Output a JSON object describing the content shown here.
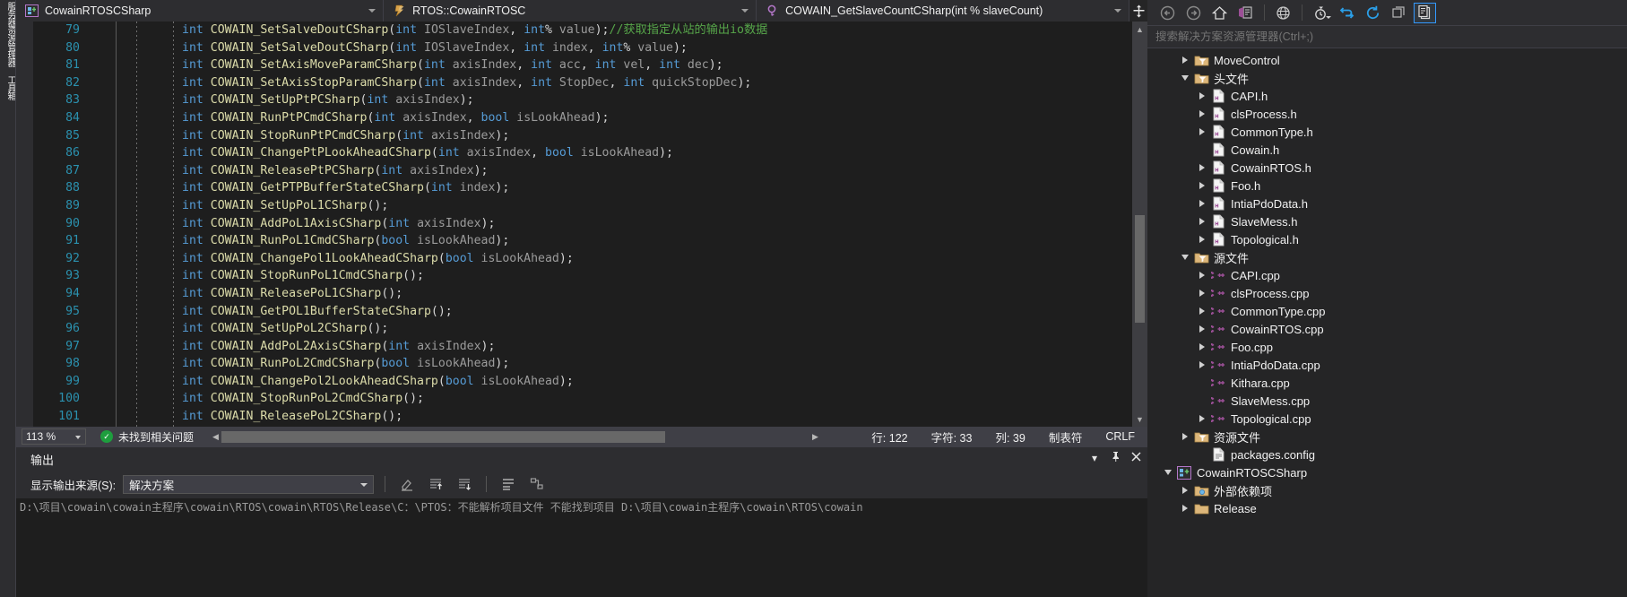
{
  "vertical_dock": {
    "tabs": [
      "服务器资源管理器",
      "工具箱"
    ]
  },
  "navigation_bar": {
    "project": {
      "label": "CowainRTOSCSharp",
      "icon": "cpp-project-icon"
    },
    "type": {
      "label": "RTOS::CowainRTOSC",
      "icon": "namespace-icon"
    },
    "member": {
      "label": "COWAIN_GetSlaveCountCSharp(int % slaveCount)",
      "icon": "method-icon"
    },
    "split_icon": "split-view-icon"
  },
  "editor": {
    "first_line": 79,
    "lines": [
      {
        "n": 79,
        "tokens": [
          [
            "kw",
            "int"
          ],
          [
            "pun",
            " "
          ],
          [
            "fn",
            "COWAIN_SetSalveDoutCSharp"
          ],
          [
            "pun",
            "("
          ],
          [
            "kw",
            "int"
          ],
          [
            "pun",
            " "
          ],
          [
            "id",
            "IOSlaveIndex"
          ],
          [
            "pun",
            ", "
          ],
          [
            "kw",
            "int"
          ],
          [
            "pun",
            "% "
          ],
          [
            "id",
            "value"
          ],
          [
            "pun",
            ");"
          ],
          [
            "cmt",
            "//获取指定从站的输出io数据"
          ]
        ]
      },
      {
        "n": 80,
        "tokens": [
          [
            "kw",
            "int"
          ],
          [
            "pun",
            " "
          ],
          [
            "fn",
            "COWAIN_SetSalveDoutCSharp"
          ],
          [
            "pun",
            "("
          ],
          [
            "kw",
            "int"
          ],
          [
            "pun",
            " "
          ],
          [
            "id",
            "IOSlaveIndex"
          ],
          [
            "pun",
            ", "
          ],
          [
            "kw",
            "int"
          ],
          [
            "pun",
            " "
          ],
          [
            "id",
            "index"
          ],
          [
            "pun",
            ", "
          ],
          [
            "kw",
            "int"
          ],
          [
            "pun",
            "% "
          ],
          [
            "id",
            "value"
          ],
          [
            "pun",
            ");"
          ]
        ]
      },
      {
        "n": 81,
        "tokens": [
          [
            "kw",
            "int"
          ],
          [
            "pun",
            " "
          ],
          [
            "fn",
            "COWAIN_SetAxisMoveParamCSharp"
          ],
          [
            "pun",
            "("
          ],
          [
            "kw",
            "int"
          ],
          [
            "pun",
            " "
          ],
          [
            "id",
            "axisIndex"
          ],
          [
            "pun",
            ", "
          ],
          [
            "kw",
            "int"
          ],
          [
            "pun",
            " "
          ],
          [
            "id",
            "acc"
          ],
          [
            "pun",
            ", "
          ],
          [
            "kw",
            "int"
          ],
          [
            "pun",
            " "
          ],
          [
            "id",
            "vel"
          ],
          [
            "pun",
            ", "
          ],
          [
            "kw",
            "int"
          ],
          [
            "pun",
            " "
          ],
          [
            "id",
            "dec"
          ],
          [
            "pun",
            ");"
          ]
        ]
      },
      {
        "n": 82,
        "tokens": [
          [
            "kw",
            "int"
          ],
          [
            "pun",
            " "
          ],
          [
            "fn",
            "COWAIN_SetAxisStopParamCSharp"
          ],
          [
            "pun",
            "("
          ],
          [
            "kw",
            "int"
          ],
          [
            "pun",
            " "
          ],
          [
            "id",
            "axisIndex"
          ],
          [
            "pun",
            ", "
          ],
          [
            "kw",
            "int"
          ],
          [
            "pun",
            " "
          ],
          [
            "id",
            "StopDec"
          ],
          [
            "pun",
            ", "
          ],
          [
            "kw",
            "int"
          ],
          [
            "pun",
            " "
          ],
          [
            "id",
            "quickStopDec"
          ],
          [
            "pun",
            ");"
          ]
        ]
      },
      {
        "n": 83,
        "tokens": [
          [
            "kw",
            "int"
          ],
          [
            "pun",
            " "
          ],
          [
            "fn",
            "COWAIN_SetUpPtPCSharp"
          ],
          [
            "pun",
            "("
          ],
          [
            "kw",
            "int"
          ],
          [
            "pun",
            " "
          ],
          [
            "id",
            "axisIndex"
          ],
          [
            "pun",
            ");"
          ]
        ]
      },
      {
        "n": 84,
        "tokens": [
          [
            "kw",
            "int"
          ],
          [
            "pun",
            " "
          ],
          [
            "fn",
            "COWAIN_RunPtPCmdCSharp"
          ],
          [
            "pun",
            "("
          ],
          [
            "kw",
            "int"
          ],
          [
            "pun",
            " "
          ],
          [
            "id",
            "axisIndex"
          ],
          [
            "pun",
            ", "
          ],
          [
            "kw",
            "bool"
          ],
          [
            "pun",
            " "
          ],
          [
            "id",
            "isLookAhead"
          ],
          [
            "pun",
            ");"
          ]
        ]
      },
      {
        "n": 85,
        "tokens": [
          [
            "kw",
            "int"
          ],
          [
            "pun",
            " "
          ],
          [
            "fn",
            "COWAIN_StopRunPtPCmdCSharp"
          ],
          [
            "pun",
            "("
          ],
          [
            "kw",
            "int"
          ],
          [
            "pun",
            " "
          ],
          [
            "id",
            "axisIndex"
          ],
          [
            "pun",
            ");"
          ]
        ]
      },
      {
        "n": 86,
        "tokens": [
          [
            "kw",
            "int"
          ],
          [
            "pun",
            " "
          ],
          [
            "fn",
            "COWAIN_ChangePtPLookAheadCSharp"
          ],
          [
            "pun",
            "("
          ],
          [
            "kw",
            "int"
          ],
          [
            "pun",
            " "
          ],
          [
            "id",
            "axisIndex"
          ],
          [
            "pun",
            ", "
          ],
          [
            "kw",
            "bool"
          ],
          [
            "pun",
            " "
          ],
          [
            "id",
            "isLookAhead"
          ],
          [
            "pun",
            ");"
          ]
        ]
      },
      {
        "n": 87,
        "tokens": [
          [
            "kw",
            "int"
          ],
          [
            "pun",
            " "
          ],
          [
            "fn",
            "COWAIN_ReleasePtPCSharp"
          ],
          [
            "pun",
            "("
          ],
          [
            "kw",
            "int"
          ],
          [
            "pun",
            " "
          ],
          [
            "id",
            "axisIndex"
          ],
          [
            "pun",
            ");"
          ]
        ]
      },
      {
        "n": 88,
        "tokens": [
          [
            "kw",
            "int"
          ],
          [
            "pun",
            " "
          ],
          [
            "fn",
            "COWAIN_GetPTPBufferStateCSharp"
          ],
          [
            "pun",
            "("
          ],
          [
            "kw",
            "int"
          ],
          [
            "pun",
            " "
          ],
          [
            "id",
            "index"
          ],
          [
            "pun",
            ");"
          ]
        ]
      },
      {
        "n": 89,
        "tokens": [
          [
            "kw",
            "int"
          ],
          [
            "pun",
            " "
          ],
          [
            "fn",
            "COWAIN_SetUpPoL1CSharp"
          ],
          [
            "pun",
            "();"
          ]
        ]
      },
      {
        "n": 90,
        "tokens": [
          [
            "kw",
            "int"
          ],
          [
            "pun",
            " "
          ],
          [
            "fn",
            "COWAIN_AddPoL1AxisCSharp"
          ],
          [
            "pun",
            "("
          ],
          [
            "kw",
            "int"
          ],
          [
            "pun",
            " "
          ],
          [
            "id",
            "axisIndex"
          ],
          [
            "pun",
            ");"
          ]
        ]
      },
      {
        "n": 91,
        "tokens": [
          [
            "kw",
            "int"
          ],
          [
            "pun",
            " "
          ],
          [
            "fn",
            "COWAIN_RunPoL1CmdCSharp"
          ],
          [
            "pun",
            "("
          ],
          [
            "kw",
            "bool"
          ],
          [
            "pun",
            " "
          ],
          [
            "id",
            "isLookAhead"
          ],
          [
            "pun",
            ");"
          ]
        ]
      },
      {
        "n": 92,
        "tokens": [
          [
            "kw",
            "int"
          ],
          [
            "pun",
            " "
          ],
          [
            "fn",
            "COWAIN_ChangePol1LookAheadCSharp"
          ],
          [
            "pun",
            "("
          ],
          [
            "kw",
            "bool"
          ],
          [
            "pun",
            " "
          ],
          [
            "id",
            "isLookAhead"
          ],
          [
            "pun",
            ");"
          ]
        ]
      },
      {
        "n": 93,
        "tokens": [
          [
            "kw",
            "int"
          ],
          [
            "pun",
            " "
          ],
          [
            "fn",
            "COWAIN_StopRunPoL1CmdCSharp"
          ],
          [
            "pun",
            "();"
          ]
        ]
      },
      {
        "n": 94,
        "tokens": [
          [
            "kw",
            "int"
          ],
          [
            "pun",
            " "
          ],
          [
            "fn",
            "COWAIN_ReleasePoL1CSharp"
          ],
          [
            "pun",
            "();"
          ]
        ]
      },
      {
        "n": 95,
        "tokens": [
          [
            "kw",
            "int"
          ],
          [
            "pun",
            " "
          ],
          [
            "fn",
            "COWAIN_GetPOL1BufferStateCSharp"
          ],
          [
            "pun",
            "();"
          ]
        ]
      },
      {
        "n": 96,
        "tokens": [
          [
            "kw",
            "int"
          ],
          [
            "pun",
            " "
          ],
          [
            "fn",
            "COWAIN_SetUpPoL2CSharp"
          ],
          [
            "pun",
            "();"
          ]
        ]
      },
      {
        "n": 97,
        "tokens": [
          [
            "kw",
            "int"
          ],
          [
            "pun",
            " "
          ],
          [
            "fn",
            "COWAIN_AddPoL2AxisCSharp"
          ],
          [
            "pun",
            "("
          ],
          [
            "kw",
            "int"
          ],
          [
            "pun",
            " "
          ],
          [
            "id",
            "axisIndex"
          ],
          [
            "pun",
            ");"
          ]
        ]
      },
      {
        "n": 98,
        "tokens": [
          [
            "kw",
            "int"
          ],
          [
            "pun",
            " "
          ],
          [
            "fn",
            "COWAIN_RunPoL2CmdCSharp"
          ],
          [
            "pun",
            "("
          ],
          [
            "kw",
            "bool"
          ],
          [
            "pun",
            " "
          ],
          [
            "id",
            "isLookAhead"
          ],
          [
            "pun",
            ");"
          ]
        ]
      },
      {
        "n": 99,
        "tokens": [
          [
            "kw",
            "int"
          ],
          [
            "pun",
            " "
          ],
          [
            "fn",
            "COWAIN_ChangePol2LookAheadCSharp"
          ],
          [
            "pun",
            "("
          ],
          [
            "kw",
            "bool"
          ],
          [
            "pun",
            " "
          ],
          [
            "id",
            "isLookAhead"
          ],
          [
            "pun",
            ");"
          ]
        ]
      },
      {
        "n": 100,
        "tokens": [
          [
            "kw",
            "int"
          ],
          [
            "pun",
            " "
          ],
          [
            "fn",
            "COWAIN_StopRunPoL2CmdCSharp"
          ],
          [
            "pun",
            "();"
          ]
        ]
      },
      {
        "n": 101,
        "tokens": [
          [
            "kw",
            "int"
          ],
          [
            "pun",
            " "
          ],
          [
            "fn",
            "COWAIN_ReleasePoL2CSharp"
          ],
          [
            "pun",
            "();"
          ]
        ]
      }
    ]
  },
  "editor_status": {
    "zoom": "113 %",
    "problems": "未找到相关问题",
    "line_label": "行: 122",
    "char_label": "字符: 33",
    "col_label": "列: 39",
    "tabs_label": "制表符",
    "eol_label": "CRLF"
  },
  "output": {
    "title": "输出",
    "source_label": "显示输出来源(S):",
    "source_value": "解决方案",
    "toolbar_icons": [
      "clear-output-icon",
      "scroll-up-icon",
      "scroll-down-icon",
      "word-wrap-icon",
      "toggle-tree-icon"
    ],
    "header_icons": [
      "chevron-down-icon",
      "pin-icon",
      "close-icon"
    ],
    "body_text": "D:\\项目\\cowain\\cowain主程序\\cowain\\RTOS\\cowain\\RTOS\\Release\\C：\\PTOS：不能解析项目文件 不能找到项目 D:\\项目\\cowain主程序\\cowain\\RTOS\\cowain"
  },
  "solution_explorer": {
    "toolbar": [
      "back-icon",
      "forward-icon",
      "home-icon",
      "sync-with-active-document-icon",
      "globe-icon",
      "pending-changes-filter-icon",
      "refresh-icon",
      "collapse-all-icon",
      "show-all-files-icon",
      "properties-icon"
    ],
    "search_placeholder": "搜索解决方案资源管理器(Ctrl+;)",
    "tree": [
      {
        "label": "MoveControl",
        "icon": "filter-folder-icon",
        "indent": 1,
        "state": "collapsed"
      },
      {
        "label": "头文件",
        "icon": "filter-folder-icon",
        "indent": 1,
        "state": "expanded"
      },
      {
        "label": "CAPI.h",
        "icon": "h-file-icon",
        "indent": 2,
        "state": "collapsed"
      },
      {
        "label": "clsProcess.h",
        "icon": "h-file-icon",
        "indent": 2,
        "state": "collapsed"
      },
      {
        "label": "CommonType.h",
        "icon": "h-file-icon",
        "indent": 2,
        "state": "collapsed"
      },
      {
        "label": "Cowain.h",
        "icon": "h-file-icon",
        "indent": 2,
        "state": "none"
      },
      {
        "label": "CowainRTOS.h",
        "icon": "h-file-icon",
        "indent": 2,
        "state": "collapsed"
      },
      {
        "label": "Foo.h",
        "icon": "h-file-icon",
        "indent": 2,
        "state": "collapsed"
      },
      {
        "label": "IntiaPdoData.h",
        "icon": "h-file-icon",
        "indent": 2,
        "state": "collapsed"
      },
      {
        "label": "SlaveMess.h",
        "icon": "h-file-icon",
        "indent": 2,
        "state": "collapsed"
      },
      {
        "label": "Topological.h",
        "icon": "h-file-icon",
        "indent": 2,
        "state": "collapsed"
      },
      {
        "label": "源文件",
        "icon": "filter-folder-icon",
        "indent": 1,
        "state": "expanded"
      },
      {
        "label": "CAPI.cpp",
        "icon": "cpp-file-icon",
        "indent": 2,
        "state": "collapsed"
      },
      {
        "label": "clsProcess.cpp",
        "icon": "cpp-file-icon",
        "indent": 2,
        "state": "collapsed"
      },
      {
        "label": "CommonType.cpp",
        "icon": "cpp-file-icon",
        "indent": 2,
        "state": "collapsed"
      },
      {
        "label": "CowainRTOS.cpp",
        "icon": "cpp-file-icon",
        "indent": 2,
        "state": "collapsed"
      },
      {
        "label": "Foo.cpp",
        "icon": "cpp-file-icon",
        "indent": 2,
        "state": "collapsed"
      },
      {
        "label": "IntiaPdoData.cpp",
        "icon": "cpp-file-icon",
        "indent": 2,
        "state": "collapsed"
      },
      {
        "label": "Kithara.cpp",
        "icon": "cpp-file-icon",
        "indent": 2,
        "state": "none"
      },
      {
        "label": "SlaveMess.cpp",
        "icon": "cpp-file-icon",
        "indent": 2,
        "state": "none"
      },
      {
        "label": "Topological.cpp",
        "icon": "cpp-file-icon",
        "indent": 2,
        "state": "collapsed"
      },
      {
        "label": "资源文件",
        "icon": "filter-folder-icon",
        "indent": 1,
        "state": "collapsed"
      },
      {
        "label": "packages.config",
        "icon": "config-file-icon",
        "indent": 2,
        "state": "none"
      },
      {
        "label": "CowainRTOSCSharp",
        "icon": "cpp-project-icon",
        "indent": 0,
        "state": "expanded"
      },
      {
        "label": "外部依赖项",
        "icon": "deps-folder-icon",
        "indent": 1,
        "state": "collapsed"
      },
      {
        "label": "Release",
        "icon": "plain-folder-icon",
        "indent": 1,
        "state": "collapsed"
      }
    ]
  },
  "colors": {
    "keyword": "#569cd6",
    "function": "#dcdcaa",
    "identifier": "#9b9b9b",
    "comment": "#57a64a",
    "linenumber": "#2b91af",
    "accent": "#007acc",
    "folder": "#dcb67a"
  }
}
